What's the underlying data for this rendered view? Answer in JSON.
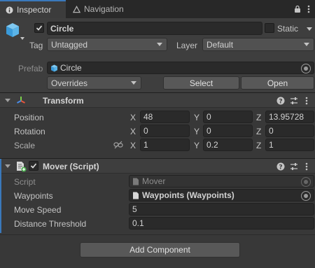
{
  "tabs": [
    {
      "label": "Inspector",
      "icon": "info-icon"
    },
    {
      "label": "Navigation",
      "icon": "navigation-icon"
    }
  ],
  "object": {
    "name": "Circle",
    "active": true,
    "static_label": "Static",
    "static": false,
    "tag_label": "Tag",
    "tag": "Untagged",
    "layer_label": "Layer",
    "layer": "Default",
    "prefab_label": "Prefab",
    "prefab_name": "Circle",
    "overrides": "Overrides",
    "select": "Select",
    "open": "Open"
  },
  "transform": {
    "title": "Transform",
    "rows": [
      {
        "label": "Position",
        "x": "48",
        "y": "0",
        "z": "13.95728"
      },
      {
        "label": "Rotation",
        "x": "0",
        "y": "0",
        "z": "0"
      },
      {
        "label": "Scale",
        "x": "1",
        "y": "0.2",
        "z": "1"
      }
    ],
    "axis": {
      "x": "X",
      "y": "Y",
      "z": "Z"
    }
  },
  "mover": {
    "title": "Mover (Script)",
    "enabled": true,
    "script_label": "Script",
    "script_value": "Mover",
    "waypoints_label": "Waypoints",
    "waypoints_value": "Waypoints (Waypoints)",
    "move_speed_label": "Move Speed",
    "move_speed_value": "5",
    "distance_label": "Distance Threshold",
    "distance_value": "0.1"
  },
  "add_component": "Add Component",
  "colors": {
    "accent": "#3a79bb",
    "panel": "#383838",
    "field": "#2a2a2a"
  }
}
